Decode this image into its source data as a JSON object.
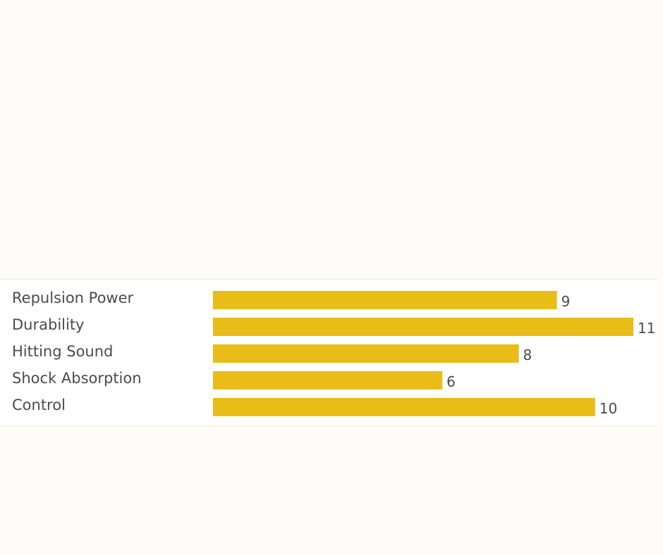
{
  "chart_data": {
    "type": "bar",
    "orientation": "horizontal",
    "categories": [
      "Repulsion Power",
      "Durability",
      "Hitting Sound",
      "Shock Absorption",
      "Control"
    ],
    "values": [
      9,
      11,
      8,
      6,
      10
    ],
    "title": "",
    "xlabel": "",
    "ylabel": "",
    "xlim": [
      0,
      11
    ],
    "grid": false,
    "legend": "none",
    "bar_color": "#e9bc17"
  }
}
